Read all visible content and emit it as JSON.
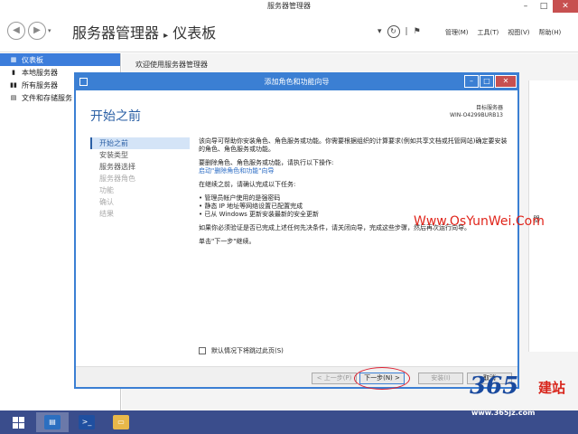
{
  "window": {
    "title": "服务器管理器"
  },
  "header": {
    "breadcrumb_root": "服务器管理器",
    "separator": "▸",
    "breadcrumb_current": "仪表板",
    "menus": [
      "管理(M)",
      "工具(T)",
      "视图(V)",
      "帮助(H)"
    ]
  },
  "sidebar": {
    "items": [
      {
        "label": "仪表板",
        "icon": "dashboard-icon"
      },
      {
        "label": "本地服务器",
        "icon": "server-icon"
      },
      {
        "label": "所有服务器",
        "icon": "servers-icon"
      },
      {
        "label": "文件和存储服务",
        "icon": "storage-icon"
      }
    ]
  },
  "main": {
    "welcome": "欢迎使用服务器管理器"
  },
  "wizard": {
    "title": "添加角色和功能向导",
    "heading": "开始之前",
    "target_label": "目标服务器",
    "target_server": "WIN-O4299BURB13",
    "steps": [
      {
        "label": "开始之前",
        "state": "active"
      },
      {
        "label": "安装类型",
        "state": "normal"
      },
      {
        "label": "服务器选择",
        "state": "normal"
      },
      {
        "label": "服务器角色",
        "state": "disabled"
      },
      {
        "label": "功能",
        "state": "disabled"
      },
      {
        "label": "确认",
        "state": "disabled"
      },
      {
        "label": "结果",
        "state": "disabled"
      }
    ],
    "para1": "该向导可帮助你安装角色、角色服务或功能。你需要根据组织的计算要求(例如共享文档或托管网站)确定要安装的角色、角色服务或功能。",
    "para2": "要删除角色、角色服务或功能，请执行以下操作:",
    "link_remove": "启动\"删除角色和功能\"向导",
    "para3": "在继续之前，请确认完成以下任务:",
    "tasks": [
      "管理员帐户使用的是强密码",
      "静态 IP 地址等网络设置已配置完成",
      "已从 Windows 更新安装最新的安全更新"
    ],
    "para4": "如果你必须验证是否已完成上述任何先决条件，请关闭向导，完成这些步骤，然后再次运行向导。",
    "para5": "单击\"下一步\"继续。",
    "skip_label": "默认情况下将跳过此页(S)",
    "buttons": {
      "prev": "< 上一步(P)",
      "next": "下一步(N) >",
      "install": "安装(I)",
      "cancel": "取消"
    }
  },
  "watermark": {
    "text": "Www.OsYunWei.Com",
    "color": "#e0241a"
  },
  "partial_bg_text": "器",
  "brand": {
    "num": "365",
    "cn": "建站",
    "url": "www.365jz.com"
  },
  "taskbar": {
    "items": [
      {
        "icon": "start-icon"
      },
      {
        "icon": "server-manager-icon",
        "active": true
      },
      {
        "icon": "powershell-icon"
      },
      {
        "icon": "file-explorer-icon"
      }
    ]
  },
  "colors": {
    "accent": "#3b7fd3",
    "taskbar": "#3a4d8c",
    "heading": "#2a5fa5"
  }
}
